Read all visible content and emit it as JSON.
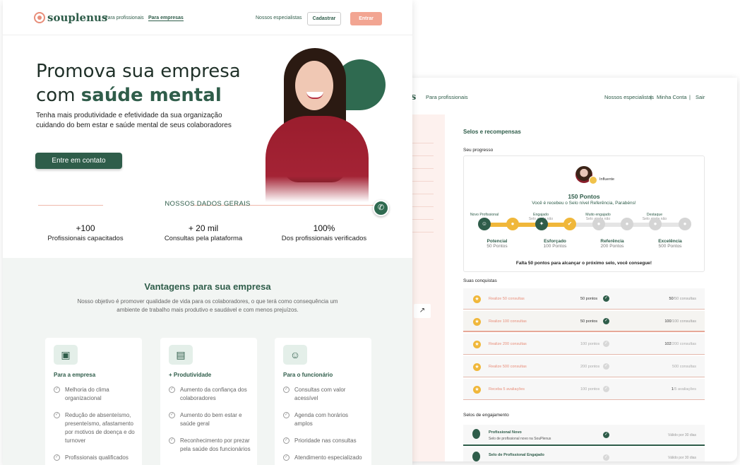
{
  "site": {
    "logo": "souplenus",
    "nav": [
      "Para profissionais",
      "Para empresas",
      "Nossos especialistas"
    ],
    "btn_cadastrar": "Cadastrar",
    "btn_entrar": "Entrar"
  },
  "hero": {
    "line1": "Promova sua empresa",
    "line2_pre": "com ",
    "line2_bold": "saúde mental",
    "para": "Tenha mais produtividade e efetividade da sua organização cuidando do bem estar e saúde mental de seus colaboradores",
    "cta": "Entre em contato"
  },
  "dados": {
    "title": "NOSSOS DADOS GERAIS",
    "stats": [
      {
        "value": "+100",
        "label": "Profissionais capacitados"
      },
      {
        "value": "+ 20 mil",
        "label": "Consultas pela plataforma"
      },
      {
        "value": "100%",
        "label": "Dos profissionais verificados"
      }
    ]
  },
  "vantagens": {
    "title": "Vantagens para sua empresa",
    "para": "Nosso objetivo é promover qualidade de vida para os colaboradores, o que terá como consequência um ambiente de trabalho mais produtivo e saudável e com menos prejuízos.",
    "cards": [
      {
        "title": "Para a empresa",
        "items": [
          "Melhoria do clima organizacional",
          "Redução de absenteísmo, presenteísmo, afastamento por motivos de doença e do turnover",
          "Profissionais qualificados"
        ]
      },
      {
        "title": "+ Produtividade",
        "items": [
          "Aumento da confiança dos colaboradores",
          "Aumento do bem estar e saúde geral",
          "Reconhecimento por prezar pela saúde dos funcionários"
        ]
      },
      {
        "title": "Para o funcionário",
        "items": [
          "Consultas com valor acessível",
          "Agenda com horários amplos",
          "Prioridade nas consultas",
          "Atendimento especializado"
        ]
      }
    ]
  },
  "dash": {
    "logo": "s",
    "nav_left": "Para profissionais",
    "nav_right": [
      "Nossos especialistas",
      "|",
      "Minha Conta",
      "|",
      "Sair"
    ],
    "section": "Selos e recompensas",
    "progress_title": "Seu progresso",
    "influ": "Influente",
    "points": "150 Pontos",
    "message": "Você é recebeu o Selo nível Referência, Parabéns!",
    "fill_fraction": 0.45,
    "top_labels": [
      {
        "name": "Novo Profissional",
        "sub": ""
      },
      {
        "name": "Engajado",
        "sub": "Selo ainda não obtido"
      },
      {
        "name": "Muito engajado",
        "sub": "Selo ainda não obtido"
      },
      {
        "name": "Destaque",
        "sub": "Selo ainda não obtido"
      }
    ],
    "levels": [
      {
        "name": "Potencial",
        "pts": "50 Pontos"
      },
      {
        "name": "Esforçado",
        "pts": "100 Pontos"
      },
      {
        "name": "Referência",
        "pts": "200 Pontos"
      },
      {
        "name": "Excelência",
        "pts": "500 Pontos"
      }
    ],
    "footer": "Falta 50 pontos para alcançar o próximo selo, você consegue!",
    "conquistas_title": "Suas conquistas",
    "conquistas": [
      {
        "name": "Realize 50 consultas",
        "pts": "50 pontos",
        "done": true,
        "progress": "50",
        "total": "/50 consultas"
      },
      {
        "name": "Realize 100 consultas",
        "pts": "50 pontos",
        "done": true,
        "progress": "100",
        "total": "/100 consultas"
      },
      {
        "name": "Realize 200 consultas",
        "pts": "100 pontos",
        "done": false,
        "progress": "102",
        "total": "/200 consultas"
      },
      {
        "name": "Realize 500 consultas",
        "pts": "200 pontos",
        "done": false,
        "progress": "",
        "total": "500 consultas"
      },
      {
        "name": "Receba 5 avaliações",
        "pts": "100 pontos",
        "done": false,
        "progress": "1",
        "total": "/5 avaliações"
      }
    ],
    "engaj_title": "Selos de engajamento",
    "engaj": [
      {
        "name": "Profissional Novo",
        "desc": "Selo de profissional novo na SouPlenus",
        "done": true,
        "valid": "Válido por 30 dias"
      },
      {
        "name": "Selo de Profissional Engajado",
        "desc": "",
        "done": false,
        "valid": "Válido por 30 dias"
      }
    ]
  },
  "colors": {
    "brand_green": "#2f5d4a",
    "accent_coral": "#f2a592",
    "gold": "#f0b73a"
  }
}
